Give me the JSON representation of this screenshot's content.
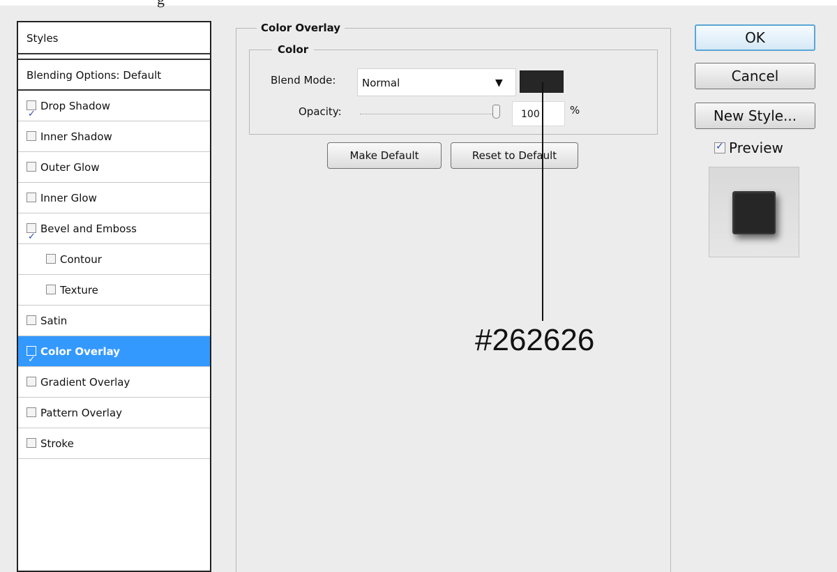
{
  "top_fragment": "g",
  "styles_panel": {
    "header": "Styles",
    "blending": "Blending Options: Default",
    "items": [
      {
        "label": "Drop Shadow",
        "checked": true,
        "indent": false,
        "selected": false
      },
      {
        "label": "Inner Shadow",
        "checked": false,
        "indent": false,
        "selected": false
      },
      {
        "label": "Outer Glow",
        "checked": false,
        "indent": false,
        "selected": false
      },
      {
        "label": "Inner Glow",
        "checked": false,
        "indent": false,
        "selected": false
      },
      {
        "label": "Bevel and Emboss",
        "checked": true,
        "indent": false,
        "selected": false
      },
      {
        "label": "Contour",
        "checked": false,
        "indent": true,
        "selected": false
      },
      {
        "label": "Texture",
        "checked": false,
        "indent": true,
        "selected": false
      },
      {
        "label": "Satin",
        "checked": false,
        "indent": false,
        "selected": false
      },
      {
        "label": "Color Overlay",
        "checked": true,
        "indent": false,
        "selected": true
      },
      {
        "label": "Gradient Overlay",
        "checked": false,
        "indent": false,
        "selected": false
      },
      {
        "label": "Pattern Overlay",
        "checked": false,
        "indent": false,
        "selected": false
      },
      {
        "label": "Stroke",
        "checked": false,
        "indent": false,
        "selected": false
      }
    ]
  },
  "color_overlay": {
    "title": "Color Overlay",
    "color_group": "Color",
    "blend_mode_label": "Blend Mode:",
    "blend_mode_value": "Normal",
    "swatch_color": "#262626",
    "opacity_label": "Opacity:",
    "opacity_value": "100",
    "opacity_unit": "%",
    "make_default": "Make Default",
    "reset_default": "Reset to Default"
  },
  "right_panel": {
    "ok": "OK",
    "cancel": "Cancel",
    "new_style": "New Style...",
    "preview_label": "Preview",
    "preview_checked": true
  },
  "annotation": {
    "text": "#262626"
  },
  "colors": {
    "selected_row": "#3399ff",
    "dialog_bg": "#ececec",
    "overlay_color": "#262626"
  }
}
